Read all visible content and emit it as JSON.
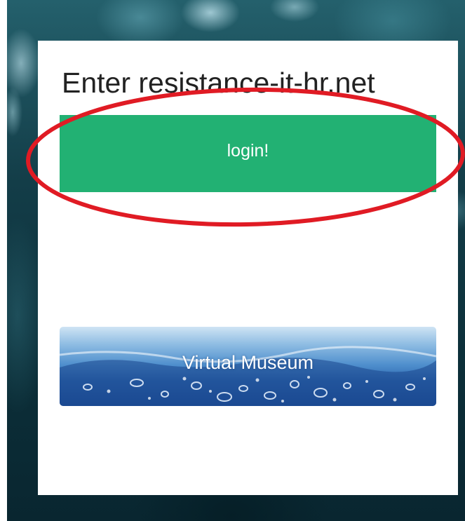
{
  "page": {
    "title": "Enter resistance-it-hr.net"
  },
  "buttons": {
    "login_label": "login!",
    "museum_label": "Virtual Museum"
  },
  "colors": {
    "login_button": "#22b173",
    "annotation_ellipse": "#e01b24",
    "card_background": "#ffffff"
  }
}
